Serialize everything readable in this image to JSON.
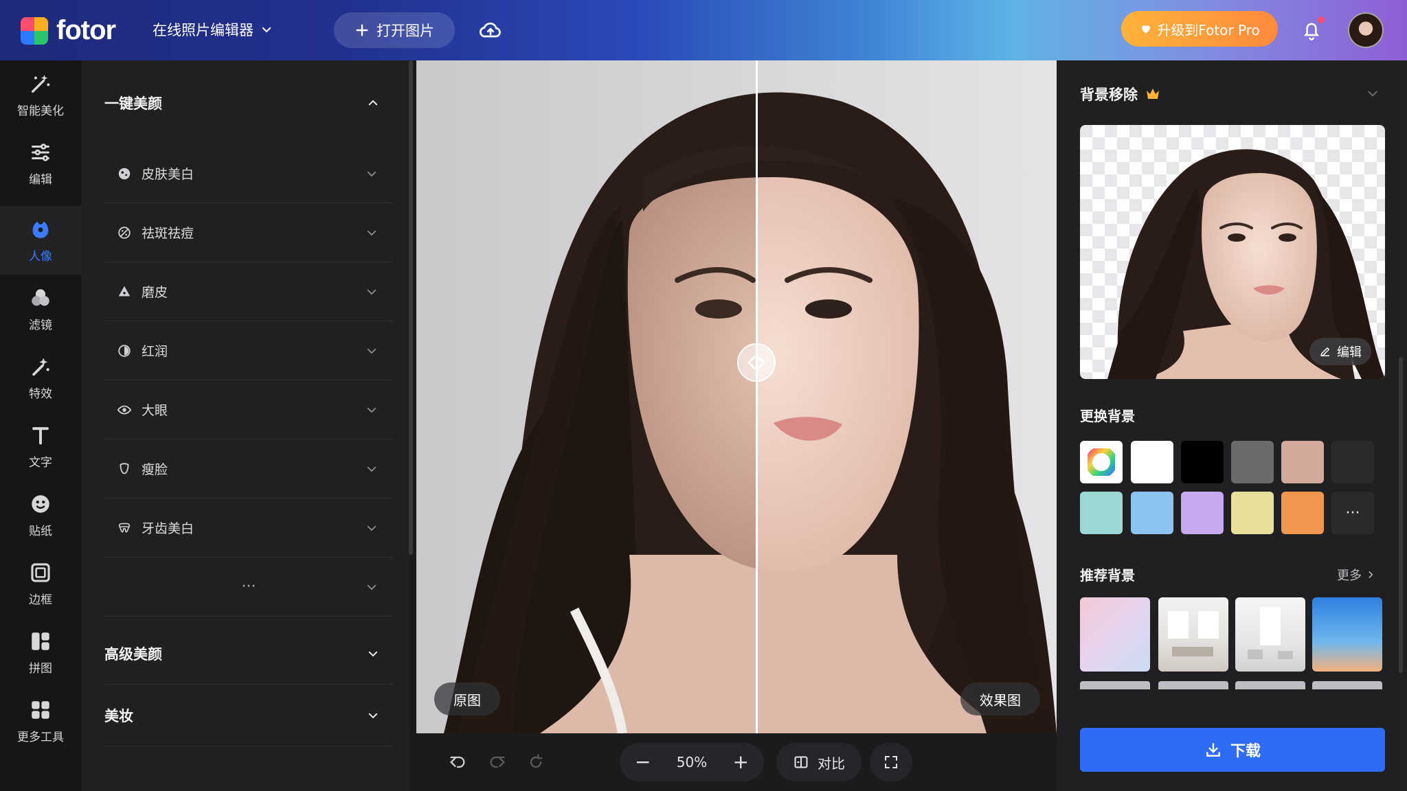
{
  "header": {
    "logo": "fotor",
    "editor_menu": "在线照片编辑器",
    "open_image": "打开图片",
    "upgrade": "升级到Fotor Pro"
  },
  "rail": [
    {
      "label": "智能美化",
      "icon": "magic-wand-icon"
    },
    {
      "label": "编辑",
      "icon": "sliders-icon"
    },
    {
      "label": "人像",
      "icon": "portrait-icon",
      "active": true
    },
    {
      "label": "滤镜",
      "icon": "filter-icon"
    },
    {
      "label": "特效",
      "icon": "effects-icon"
    },
    {
      "label": "文字",
      "icon": "text-icon"
    },
    {
      "label": "贴纸",
      "icon": "sticker-icon"
    },
    {
      "label": "边框",
      "icon": "frame-icon"
    },
    {
      "label": "拼图",
      "icon": "collage-icon"
    },
    {
      "label": "更多工具",
      "icon": "grid-icon"
    }
  ],
  "panel": {
    "section1": "一键美颜",
    "items": [
      {
        "label": "皮肤美白",
        "icon": "skin-icon"
      },
      {
        "label": "祛斑祛痘",
        "icon": "blemish-icon"
      },
      {
        "label": "磨皮",
        "icon": "smooth-icon"
      },
      {
        "label": "红润",
        "icon": "rosy-icon"
      },
      {
        "label": "大眼",
        "icon": "eye-icon"
      },
      {
        "label": "瘦脸",
        "icon": "slim-face-icon"
      },
      {
        "label": "牙齿美白",
        "icon": "teeth-icon"
      }
    ],
    "more": "···",
    "section2": "高级美颜",
    "section3": "美妆"
  },
  "canvas": {
    "left_label": "原图",
    "right_label": "效果图"
  },
  "bottom": {
    "zoom": "50%",
    "compare": "对比"
  },
  "right_panel": {
    "title": "背景移除",
    "edit": "编辑",
    "change_bg": "更换背景",
    "colors": [
      "#ffffff",
      "#000000",
      "#6b6b6e",
      "#d3a99c",
      "#2a2a2d",
      "#9dd7d3",
      "#8cc3f0",
      "#c6a9ee",
      "#e7df9a",
      "#f2964d"
    ],
    "more_dots": "···",
    "recommend": "推荐背景",
    "more": "更多",
    "download": "下载"
  }
}
